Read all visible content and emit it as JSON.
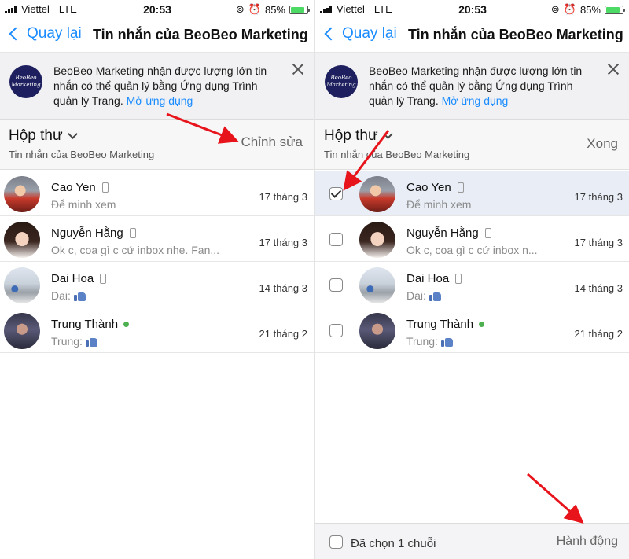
{
  "status_bar": {
    "carrier": "Viettel",
    "network": "LTE",
    "time": "20:53",
    "battery": "85%",
    "battery_level": 0.85
  },
  "nav": {
    "back_label": "Quay lại",
    "title": "Tin nhắn của BeoBeo Marketing"
  },
  "banner": {
    "logo_text": "BeoBeo Marketing",
    "text": "BeoBeo Marketing nhận được lượng lớn tin nhắn có thể quản lý bằng Ứng dụng Trình quản lý Trang.",
    "link": "Mở ứng dụng"
  },
  "inbox": {
    "title": "Hộp thư",
    "subtitle": "Tin nhắn của BeoBeo Marketing",
    "edit_label": "Chỉnh sửa",
    "done_label": "Xong"
  },
  "conversations_left": [
    {
      "name": "Cao Yen",
      "snippet": "Để minh xem",
      "date": "17 tháng 3",
      "mobile": true,
      "online": false,
      "like": false
    },
    {
      "name": "Nguyễn Hằng",
      "snippet": "Ok c, coa gì c cứ inbox nhe. Fan...",
      "date": "17 tháng 3",
      "mobile": true,
      "online": false,
      "like": false
    },
    {
      "name": "Dai Hoa",
      "snippet": "Dai:",
      "date": "14 tháng 3",
      "mobile": true,
      "online": false,
      "like": true
    },
    {
      "name": "Trung Thành",
      "snippet": "Trung:",
      "date": "21 tháng 2",
      "mobile": false,
      "online": true,
      "like": true
    }
  ],
  "conversations_right": [
    {
      "name": "Cao Yen",
      "snippet": "Để minh xem",
      "date": "17 tháng 3",
      "checked": true
    },
    {
      "name": "Nguyễn Hằng",
      "snippet": "Ok c, coa gì c cứ inbox n...",
      "date": "17 tháng 3",
      "checked": false
    },
    {
      "name": "Dai Hoa",
      "snippet": "Dai:",
      "date": "14 tháng 3",
      "checked": false
    },
    {
      "name": "Trung Thành",
      "snippet": "Trung:",
      "date": "21 tháng 2",
      "checked": false
    }
  ],
  "footer": {
    "selected_text": "Đã chọn 1 chuỗi",
    "action_label": "Hành động"
  },
  "colors": {
    "accent": "#1a8cff",
    "annotation_arrow": "#e8141c",
    "online": "#4caf50",
    "selected_row": "#e8edf6"
  }
}
